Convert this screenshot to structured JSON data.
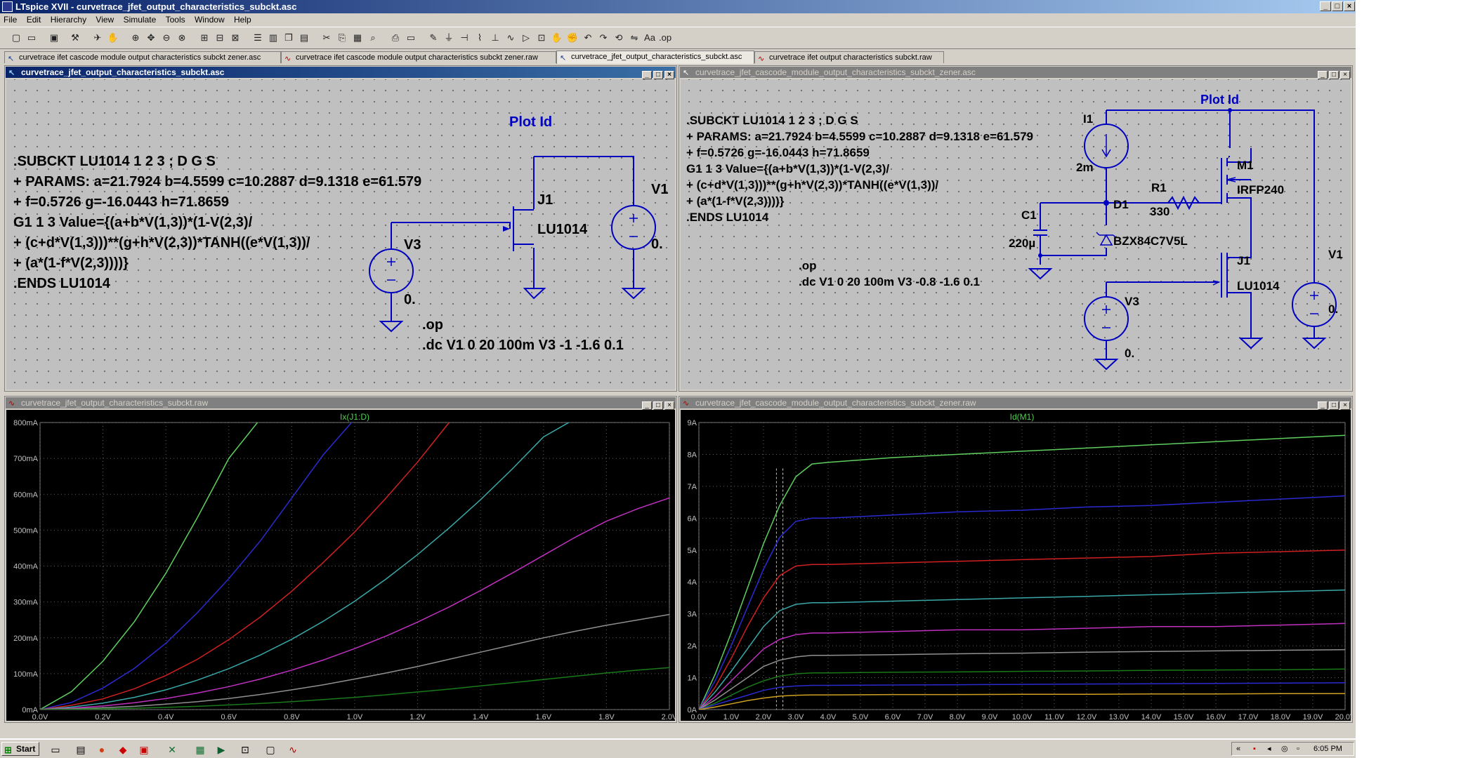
{
  "window": {
    "title": "LTspice XVII - curvetrace_jfet_output_characteristics_subckt.asc"
  },
  "menu": [
    "File",
    "Edit",
    "Hierarchy",
    "View",
    "Simulate",
    "Tools",
    "Window",
    "Help"
  ],
  "tabs": [
    {
      "label": "curvetrace ifet cascode module output characteristics subckt zener.asc",
      "icon": "schematic-icon"
    },
    {
      "label": "curvetrace ifet cascode module output characteristics subckt zener.raw",
      "icon": "waveform-icon"
    },
    {
      "label": "curvetrace_jfet_output_characteristics_subckt.asc",
      "icon": "schematic-icon"
    },
    {
      "label": "curvetrace ifet output characteristics subckt.raw",
      "icon": "waveform-icon"
    }
  ],
  "pane_tl": {
    "title": "curvetrace_jfet_output_characteristics_subckt.asc",
    "plot_label": "Plot Id",
    "subckt": [
      ".SUBCKT LU1014 1 2 3 ; D G S",
      "+ PARAMS: a=21.7924 b=4.5599 c=10.2887 d=9.1318 e=61.579",
      "+ f=0.5726 g=-16.0443 h=71.8659",
      "G1 1 3 Value={(a+b*V(1,3))*(1-V(2,3)/",
      "+ (c+d*V(1,3)))**(g+h*V(2,3))*TANH((e*V(1,3))/",
      "+ (a*(1-f*V(2,3))))}",
      ".ENDS LU1014"
    ],
    "j1_name": "J1",
    "j1_model": "LU1014",
    "v1_name": "V1",
    "v1_value": "0.",
    "v3_name": "V3",
    "v3_value": "0.",
    "directives": [
      ".op",
      ".dc V1 0 20 100m V3 -1 -1.6 0.1"
    ]
  },
  "pane_tr": {
    "title": "curvetrace_jfet_cascode_module_output_characteristics_subckt_zener.asc",
    "plot_label": "Plot Id",
    "subckt": [
      ".SUBCKT LU1014 1 2 3 ; D G S",
      "+ PARAMS: a=21.7924 b=4.5599 c=10.2887 d=9.1318 e=61.579",
      "+ f=0.5726 g=-16.0443 h=71.8659",
      "G1 1 3 Value={(a+b*V(1,3))*(1-V(2,3)/",
      "+ (c+d*V(1,3)))**(g+h*V(2,3))*TANH((e*V(1,3))/",
      "+ (a*(1-f*V(2,3))))}",
      ".ENDS LU1014"
    ],
    "i1_name": "I1",
    "i1_value": "2m",
    "r1_name": "R1",
    "r1_value": "330",
    "d1_name": "D1",
    "d1_model": "BZX84C7V5L",
    "c1_name": "C1",
    "c1_value": "220µ",
    "m1_name": "M1",
    "m1_model": "IRFP240",
    "j1_name": "J1",
    "j1_model": "LU1014",
    "v1_name": "V1",
    "v1_value": "0.",
    "v3_name": "V3",
    "v3_value": "0.",
    "directives": [
      ".op",
      ".dc V1 0 20 100m V3 -0.8 -1.6 0.1"
    ]
  },
  "pane_bl": {
    "title": "curvetrace_jfet_output_characteristics_subckt.raw"
  },
  "pane_br": {
    "title": "curvetrace_jfet_cascode_module_output_characteristics_subckt_zener.raw"
  },
  "chart_data": [
    {
      "type": "line",
      "title": "Ix(J1:D)",
      "xlim": [
        0,
        2
      ],
      "ylim": [
        0,
        800
      ],
      "x_ticks": [
        "0.0V",
        "0.2V",
        "0.4V",
        "0.6V",
        "0.8V",
        "1.0V",
        "1.2V",
        "1.4V",
        "1.6V",
        "1.8V",
        "2.0V"
      ],
      "y_ticks": [
        "0mA",
        "100mA",
        "200mA",
        "300mA",
        "400mA",
        "500mA",
        "600mA",
        "700mA",
        "800mA"
      ],
      "x": [
        0,
        0.1,
        0.2,
        0.3,
        0.4,
        0.5,
        0.6,
        0.7,
        0.8,
        0.9,
        1.0,
        1.1,
        1.2,
        1.3,
        1.4,
        1.5,
        1.6,
        1.7,
        1.8,
        1.9,
        2.0
      ],
      "series": [
        {
          "color": "#5ecf5e",
          "values": [
            0,
            50,
            135,
            245,
            380,
            535,
            700,
            810
          ]
        },
        {
          "color": "#2a2ad0",
          "values": [
            0,
            20,
            60,
            115,
            185,
            270,
            365,
            470,
            590,
            710,
            810
          ]
        },
        {
          "color": "#d02020",
          "values": [
            0,
            12,
            30,
            58,
            95,
            140,
            195,
            258,
            330,
            410,
            495,
            590,
            690,
            800
          ]
        },
        {
          "color": "#3aa8a8",
          "values": [
            0,
            7,
            18,
            34,
            55,
            82,
            114,
            152,
            196,
            246,
            302,
            364,
            432,
            506,
            585,
            670,
            760,
            810
          ]
        },
        {
          "color": "#c030c0",
          "values": [
            0,
            4,
            10,
            19,
            31,
            46,
            64,
            85,
            110,
            138,
            170,
            205,
            244,
            286,
            332,
            380,
            430,
            480,
            525,
            560,
            590
          ]
        },
        {
          "color": "#909090",
          "values": [
            0,
            2,
            5,
            9,
            15,
            22,
            31,
            42,
            55,
            69,
            85,
            102,
            120,
            140,
            160,
            180,
            200,
            218,
            235,
            250,
            265
          ]
        },
        {
          "color": "#1a7a1a",
          "values": [
            0,
            1,
            2,
            4,
            6,
            9,
            13,
            17,
            22,
            28,
            34,
            41,
            49,
            57,
            66,
            75,
            84,
            93,
            102,
            110,
            117
          ]
        }
      ]
    },
    {
      "type": "line",
      "title": "Id(M1)",
      "xlim": [
        0,
        20
      ],
      "ylim": [
        0,
        9
      ],
      "x_ticks": [
        "0.0V",
        "1.0V",
        "2.0V",
        "3.0V",
        "4.0V",
        "5.0V",
        "6.0V",
        "7.0V",
        "8.0V",
        "9.0V",
        "10.0V",
        "11.0V",
        "12.0V",
        "13.0V",
        "14.0V",
        "15.0V",
        "16.0V",
        "17.0V",
        "18.0V",
        "19.0V",
        "20.0V"
      ],
      "y_ticks": [
        "0A",
        "1A",
        "2A",
        "3A",
        "4A",
        "5A",
        "6A",
        "7A",
        "8A",
        "9A"
      ],
      "x": [
        0,
        0.5,
        1,
        1.5,
        2,
        2.5,
        3,
        3.5,
        4,
        6,
        8,
        10,
        12,
        14,
        16,
        18,
        20
      ],
      "series": [
        {
          "color": "#5ecf5e",
          "values": [
            0,
            1.1,
            2.4,
            3.8,
            5.2,
            6.4,
            7.3,
            7.7,
            7.75,
            7.9,
            8.0,
            8.1,
            8.2,
            8.3,
            8.4,
            8.5,
            8.6
          ]
        },
        {
          "color": "#2a2ad0",
          "values": [
            0,
            0.9,
            2.0,
            3.2,
            4.4,
            5.4,
            5.9,
            6.0,
            6.0,
            6.1,
            6.2,
            6.25,
            6.35,
            6.4,
            6.5,
            6.6,
            6.7
          ]
        },
        {
          "color": "#d02020",
          "values": [
            0,
            0.7,
            1.6,
            2.6,
            3.5,
            4.2,
            4.5,
            4.55,
            4.55,
            4.6,
            4.65,
            4.7,
            4.75,
            4.8,
            4.9,
            4.95,
            5.0
          ]
        },
        {
          "color": "#3aa8a8",
          "values": [
            0,
            0.55,
            1.2,
            1.9,
            2.6,
            3.1,
            3.3,
            3.35,
            3.35,
            3.4,
            3.45,
            3.5,
            3.55,
            3.6,
            3.65,
            3.7,
            3.75
          ]
        },
        {
          "color": "#c030c0",
          "values": [
            0,
            0.4,
            0.9,
            1.4,
            1.9,
            2.2,
            2.35,
            2.4,
            2.4,
            2.45,
            2.5,
            2.5,
            2.55,
            2.6,
            2.6,
            2.65,
            2.7
          ]
        },
        {
          "color": "#909090",
          "values": [
            0,
            0.3,
            0.65,
            1.0,
            1.35,
            1.55,
            1.65,
            1.7,
            1.7,
            1.72,
            1.75,
            1.77,
            1.8,
            1.82,
            1.84,
            1.86,
            1.88
          ]
        },
        {
          "color": "#1a7a1a",
          "values": [
            0,
            0.2,
            0.45,
            0.7,
            0.9,
            1.05,
            1.12,
            1.15,
            1.15,
            1.17,
            1.18,
            1.2,
            1.21,
            1.23,
            1.24,
            1.25,
            1.27
          ]
        },
        {
          "color": "#2a2ad0",
          "values": [
            0,
            0.15,
            0.3,
            0.45,
            0.6,
            0.7,
            0.74,
            0.76,
            0.76,
            0.77,
            0.78,
            0.79,
            0.8,
            0.81,
            0.82,
            0.83,
            0.84
          ]
        },
        {
          "color": "#d0a020",
          "values": [
            0,
            0.08,
            0.18,
            0.28,
            0.36,
            0.42,
            0.45,
            0.46,
            0.46,
            0.47,
            0.47,
            0.48,
            0.48,
            0.49,
            0.49,
            0.5,
            0.5
          ]
        }
      ],
      "cursors": [
        {
          "x": 2.4,
          "color": "#d8c868"
        },
        {
          "x": 2.6,
          "color": "#d0d0d0"
        }
      ]
    }
  ],
  "taskbar": {
    "start": "Start",
    "time": "6:05 PM"
  },
  "colors": {
    "wire": "#0000c0",
    "plot_bg": "#000000",
    "schem_bg": "#c0c0c0",
    "title_active": "#0a246a"
  }
}
